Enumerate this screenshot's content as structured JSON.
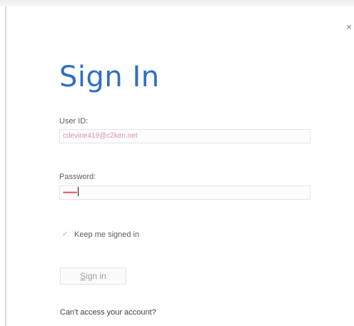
{
  "dialog": {
    "close_glyph": "×",
    "title": "Sign In"
  },
  "form": {
    "user_label": "User ID:",
    "user_value": "cdevine419@c2ken.net",
    "password_label": "Password:",
    "password_mask": "•••••••••",
    "keep_signed_in_label": "Keep me signed in",
    "keep_signed_in_checked": true,
    "signin_button_first": "S",
    "signin_button_rest": "ign in",
    "help_link": "Can't access your account?"
  },
  "colors": {
    "title": "#2f6fc3",
    "label": "#595c63"
  }
}
